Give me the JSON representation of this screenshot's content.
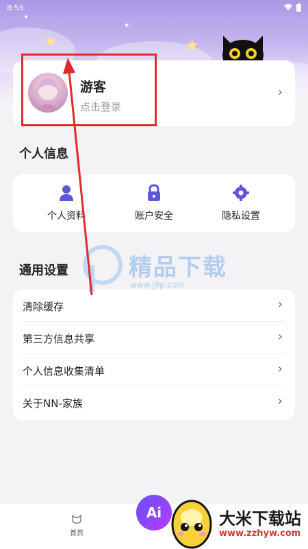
{
  "status_bar": {
    "time": "8:55"
  },
  "profile": {
    "name": "游客",
    "login_hint": "点击登录"
  },
  "personal_info": {
    "title": "个人信息",
    "items": [
      {
        "label": "个人资料",
        "icon": "user-icon"
      },
      {
        "label": "账户安全",
        "icon": "lock-icon"
      },
      {
        "label": "隐私设置",
        "icon": "gear-icon"
      }
    ]
  },
  "general_settings": {
    "title": "通用设置",
    "rows": [
      {
        "label": "清除缓存"
      },
      {
        "label": "第三方信息共享"
      },
      {
        "label": "个人信息收集清单"
      },
      {
        "label": "关于NN-家族"
      }
    ]
  },
  "watermark": {
    "title": "精品下载",
    "url": "www.j9p.com"
  },
  "bottom_nav": {
    "home_label": "首页",
    "ai_label": "Ai"
  },
  "brand_watermark": {
    "title": "大米下载站",
    "url": "www.zzhyw.com"
  },
  "colors": {
    "accent": "#5b57d6",
    "annotation_red": "#e02a2a",
    "background": "#f3f3f5"
  }
}
